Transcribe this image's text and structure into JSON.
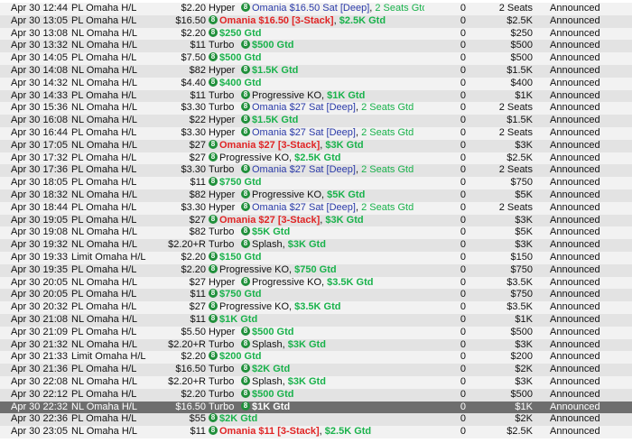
{
  "tournaments": [
    {
      "date": "Apr 30",
      "time": "12:44",
      "game": "PL Omaha H/L",
      "buyin": "$2.20",
      "speed": "Hyper",
      "name": [
        {
          "t": "Omania $16.50 Sat [Deep]",
          "c": "blue"
        },
        {
          "t": ", ",
          "c": "dark"
        },
        {
          "t": "2 Seats Gtd",
          "c": "green"
        }
      ],
      "entrants": "0",
      "prize": "2 Seats",
      "status": "Announced"
    },
    {
      "date": "Apr 30",
      "time": "13:05",
      "game": "PL Omaha H/L",
      "buyin": "$16.50",
      "speed": "",
      "name": [
        {
          "t": "Omania $16.50 [3-Stack]",
          "c": "red",
          "b": true
        },
        {
          "t": ", ",
          "c": "dark"
        },
        {
          "t": "$2.5K Gtd",
          "c": "green",
          "b": true
        }
      ],
      "entrants": "0",
      "prize": "$2.5K",
      "status": "Announced"
    },
    {
      "date": "Apr 30",
      "time": "13:08",
      "game": "NL Omaha H/L",
      "buyin": "$2.20",
      "speed": "",
      "name": [
        {
          "t": "$250 Gtd",
          "c": "green",
          "b": true
        }
      ],
      "entrants": "0",
      "prize": "$250",
      "status": "Announced"
    },
    {
      "date": "Apr 30",
      "time": "13:32",
      "game": "NL Omaha H/L",
      "buyin": "$11",
      "speed": "Turbo",
      "name": [
        {
          "t": "$500 Gtd",
          "c": "green",
          "b": true
        }
      ],
      "entrants": "0",
      "prize": "$500",
      "status": "Announced"
    },
    {
      "date": "Apr 30",
      "time": "14:05",
      "game": "PL Omaha H/L",
      "buyin": "$7.50",
      "speed": "",
      "name": [
        {
          "t": "$500 Gtd",
          "c": "green",
          "b": true
        }
      ],
      "entrants": "0",
      "prize": "$500",
      "status": "Announced"
    },
    {
      "date": "Apr 30",
      "time": "14:08",
      "game": "NL Omaha H/L",
      "buyin": "$82",
      "speed": "Hyper",
      "name": [
        {
          "t": "$1.5K Gtd",
          "c": "green",
          "b": true
        }
      ],
      "entrants": "0",
      "prize": "$1.5K",
      "status": "Announced"
    },
    {
      "date": "Apr 30",
      "time": "14:32",
      "game": "NL Omaha H/L",
      "buyin": "$4.40",
      "speed": "",
      "name": [
        {
          "t": "$400 Gtd",
          "c": "green",
          "b": true
        }
      ],
      "entrants": "0",
      "prize": "$400",
      "status": "Announced"
    },
    {
      "date": "Apr 30",
      "time": "14:33",
      "game": "PL Omaha H/L",
      "buyin": "$11",
      "speed": "Turbo",
      "name": [
        {
          "t": "Progressive KO, ",
          "c": "dark"
        },
        {
          "t": "$1K Gtd",
          "c": "green",
          "b": true
        }
      ],
      "entrants": "0",
      "prize": "$1K",
      "status": "Announced"
    },
    {
      "date": "Apr 30",
      "time": "15:36",
      "game": "NL Omaha H/L",
      "buyin": "$3.30",
      "speed": "Turbo",
      "name": [
        {
          "t": "Omania $27 Sat [Deep]",
          "c": "blue"
        },
        {
          "t": ", ",
          "c": "dark"
        },
        {
          "t": "2 Seats Gtd",
          "c": "green"
        }
      ],
      "entrants": "0",
      "prize": "2 Seats",
      "status": "Announced"
    },
    {
      "date": "Apr 30",
      "time": "16:08",
      "game": "NL Omaha H/L",
      "buyin": "$22",
      "speed": "Hyper",
      "name": [
        {
          "t": "$1.5K Gtd",
          "c": "green",
          "b": true
        }
      ],
      "entrants": "0",
      "prize": "$1.5K",
      "status": "Announced"
    },
    {
      "date": "Apr 30",
      "time": "16:44",
      "game": "PL Omaha H/L",
      "buyin": "$3.30",
      "speed": "Hyper",
      "name": [
        {
          "t": "Omania $27 Sat [Deep]",
          "c": "blue"
        },
        {
          "t": ", ",
          "c": "dark"
        },
        {
          "t": "2 Seats Gtd",
          "c": "green"
        }
      ],
      "entrants": "0",
      "prize": "2 Seats",
      "status": "Announced"
    },
    {
      "date": "Apr 30",
      "time": "17:05",
      "game": "NL Omaha H/L",
      "buyin": "$27",
      "speed": "",
      "name": [
        {
          "t": "Omania $27 [3-Stack]",
          "c": "red",
          "b": true
        },
        {
          "t": ", ",
          "c": "dark"
        },
        {
          "t": "$3K Gtd",
          "c": "green",
          "b": true
        }
      ],
      "entrants": "0",
      "prize": "$3K",
      "status": "Announced"
    },
    {
      "date": "Apr 30",
      "time": "17:32",
      "game": "PL Omaha H/L",
      "buyin": "$27",
      "speed": "",
      "name": [
        {
          "t": "Progressive KO, ",
          "c": "dark"
        },
        {
          "t": "$2.5K Gtd",
          "c": "green",
          "b": true
        }
      ],
      "entrants": "0",
      "prize": "$2.5K",
      "status": "Announced"
    },
    {
      "date": "Apr 30",
      "time": "17:36",
      "game": "PL Omaha H/L",
      "buyin": "$3.30",
      "speed": "Turbo",
      "name": [
        {
          "t": "Omania $27 Sat [Deep]",
          "c": "blue"
        },
        {
          "t": ", ",
          "c": "dark"
        },
        {
          "t": "2 Seats Gtd",
          "c": "green"
        }
      ],
      "entrants": "0",
      "prize": "2 Seats",
      "status": "Announced"
    },
    {
      "date": "Apr 30",
      "time": "18:05",
      "game": "PL Omaha H/L",
      "buyin": "$11",
      "speed": "",
      "name": [
        {
          "t": "$750 Gtd",
          "c": "green",
          "b": true
        }
      ],
      "entrants": "0",
      "prize": "$750",
      "status": "Announced"
    },
    {
      "date": "Apr 30",
      "time": "18:32",
      "game": "NL Omaha H/L",
      "buyin": "$82",
      "speed": "Hyper",
      "name": [
        {
          "t": "Progressive KO, ",
          "c": "dark"
        },
        {
          "t": "$5K Gtd",
          "c": "green",
          "b": true
        }
      ],
      "entrants": "0",
      "prize": "$5K",
      "status": "Announced"
    },
    {
      "date": "Apr 30",
      "time": "18:44",
      "game": "PL Omaha H/L",
      "buyin": "$3.30",
      "speed": "Hyper",
      "name": [
        {
          "t": "Omania $27 Sat [Deep]",
          "c": "blue"
        },
        {
          "t": ", ",
          "c": "dark"
        },
        {
          "t": "2 Seats Gtd",
          "c": "green"
        }
      ],
      "entrants": "0",
      "prize": "2 Seats",
      "status": "Announced"
    },
    {
      "date": "Apr 30",
      "time": "19:05",
      "game": "PL Omaha H/L",
      "buyin": "$27",
      "speed": "",
      "name": [
        {
          "t": "Omania $27 [3-Stack]",
          "c": "red",
          "b": true
        },
        {
          "t": ", ",
          "c": "dark"
        },
        {
          "t": "$3K Gtd",
          "c": "green",
          "b": true
        }
      ],
      "entrants": "0",
      "prize": "$3K",
      "status": "Announced"
    },
    {
      "date": "Apr 30",
      "time": "19:08",
      "game": "NL Omaha H/L",
      "buyin": "$82",
      "speed": "Turbo",
      "name": [
        {
          "t": "$5K Gtd",
          "c": "green",
          "b": true
        }
      ],
      "entrants": "0",
      "prize": "$5K",
      "status": "Announced"
    },
    {
      "date": "Apr 30",
      "time": "19:32",
      "game": "NL Omaha H/L",
      "buyin": "$2.20+R",
      "speed": "Turbo",
      "name": [
        {
          "t": "Splash, ",
          "c": "dark"
        },
        {
          "t": "$3K Gtd",
          "c": "green",
          "b": true
        }
      ],
      "entrants": "0",
      "prize": "$3K",
      "status": "Announced"
    },
    {
      "date": "Apr 30",
      "time": "19:33",
      "game": "Limit Omaha H/L",
      "buyin": "$2.20",
      "speed": "",
      "name": [
        {
          "t": "$150 Gtd",
          "c": "green",
          "b": true
        }
      ],
      "entrants": "0",
      "prize": "$150",
      "status": "Announced"
    },
    {
      "date": "Apr 30",
      "time": "19:35",
      "game": "PL Omaha H/L",
      "buyin": "$2.20",
      "speed": "",
      "name": [
        {
          "t": "Progressive KO, ",
          "c": "dark"
        },
        {
          "t": "$750 Gtd",
          "c": "green",
          "b": true
        }
      ],
      "entrants": "0",
      "prize": "$750",
      "status": "Announced"
    },
    {
      "date": "Apr 30",
      "time": "20:05",
      "game": "NL Omaha H/L",
      "buyin": "$27",
      "speed": "Hyper",
      "name": [
        {
          "t": "Progressive KO, ",
          "c": "dark"
        },
        {
          "t": "$3.5K Gtd",
          "c": "green",
          "b": true
        }
      ],
      "entrants": "0",
      "prize": "$3.5K",
      "status": "Announced"
    },
    {
      "date": "Apr 30",
      "time": "20:05",
      "game": "PL Omaha H/L",
      "buyin": "$11",
      "speed": "",
      "name": [
        {
          "t": "$750 Gtd",
          "c": "green",
          "b": true
        }
      ],
      "entrants": "0",
      "prize": "$750",
      "status": "Announced"
    },
    {
      "date": "Apr 30",
      "time": "20:32",
      "game": "PL Omaha H/L",
      "buyin": "$27",
      "speed": "",
      "name": [
        {
          "t": "Progressive KO, ",
          "c": "dark"
        },
        {
          "t": "$3.5K Gtd",
          "c": "green",
          "b": true
        }
      ],
      "entrants": "0",
      "prize": "$3.5K",
      "status": "Announced"
    },
    {
      "date": "Apr 30",
      "time": "21:08",
      "game": "NL Omaha H/L",
      "buyin": "$11",
      "speed": "",
      "name": [
        {
          "t": "$1K Gtd",
          "c": "green",
          "b": true
        }
      ],
      "entrants": "0",
      "prize": "$1K",
      "status": "Announced"
    },
    {
      "date": "Apr 30",
      "time": "21:09",
      "game": "PL Omaha H/L",
      "buyin": "$5.50",
      "speed": "Hyper",
      "name": [
        {
          "t": "$500 Gtd",
          "c": "green",
          "b": true
        }
      ],
      "entrants": "0",
      "prize": "$500",
      "status": "Announced"
    },
    {
      "date": "Apr 30",
      "time": "21:32",
      "game": "NL Omaha H/L",
      "buyin": "$2.20+R",
      "speed": "Turbo",
      "name": [
        {
          "t": "Splash, ",
          "c": "dark"
        },
        {
          "t": "$3K Gtd",
          "c": "green",
          "b": true
        }
      ],
      "entrants": "0",
      "prize": "$3K",
      "status": "Announced"
    },
    {
      "date": "Apr 30",
      "time": "21:33",
      "game": "Limit Omaha H/L",
      "buyin": "$2.20",
      "speed": "",
      "name": [
        {
          "t": "$200 Gtd",
          "c": "green",
          "b": true
        }
      ],
      "entrants": "0",
      "prize": "$200",
      "status": "Announced"
    },
    {
      "date": "Apr 30",
      "time": "21:36",
      "game": "PL Omaha H/L",
      "buyin": "$16.50",
      "speed": "Turbo",
      "name": [
        {
          "t": "$2K Gtd",
          "c": "green",
          "b": true
        }
      ],
      "entrants": "0",
      "prize": "$2K",
      "status": "Announced"
    },
    {
      "date": "Apr 30",
      "time": "22:08",
      "game": "NL Omaha H/L",
      "buyin": "$2.20+R",
      "speed": "Turbo",
      "name": [
        {
          "t": "Splash, ",
          "c": "dark"
        },
        {
          "t": "$3K Gtd",
          "c": "green",
          "b": true
        }
      ],
      "entrants": "0",
      "prize": "$3K",
      "status": "Announced"
    },
    {
      "date": "Apr 30",
      "time": "22:12",
      "game": "PL Omaha H/L",
      "buyin": "$2.20",
      "speed": "Turbo",
      "name": [
        {
          "t": "$500 Gtd",
          "c": "green",
          "b": true
        }
      ],
      "entrants": "0",
      "prize": "$500",
      "status": "Announced"
    },
    {
      "date": "Apr 30",
      "time": "22:32",
      "game": "NL Omaha H/L",
      "buyin": "$16.50",
      "speed": "Turbo",
      "name": [
        {
          "t": "$1K Gtd",
          "c": "green",
          "b": true
        }
      ],
      "entrants": "0",
      "prize": "$1K",
      "status": "Announced",
      "selected": true
    },
    {
      "date": "Apr 30",
      "time": "22:36",
      "game": "PL Omaha H/L",
      "buyin": "$55",
      "speed": "",
      "name": [
        {
          "t": "$2K Gtd",
          "c": "green",
          "b": true
        }
      ],
      "entrants": "0",
      "prize": "$2K",
      "status": "Announced"
    },
    {
      "date": "Apr 30",
      "time": "23:05",
      "game": "NL Omaha H/L",
      "buyin": "$11",
      "speed": "",
      "name": [
        {
          "t": "Omania $11 [3-Stack]",
          "c": "red",
          "b": true
        },
        {
          "t": ", ",
          "c": "dark"
        },
        {
          "t": "$2.5K Gtd",
          "c": "green",
          "b": true
        }
      ],
      "entrants": "0",
      "prize": "$2.5K",
      "status": "Announced"
    }
  ]
}
